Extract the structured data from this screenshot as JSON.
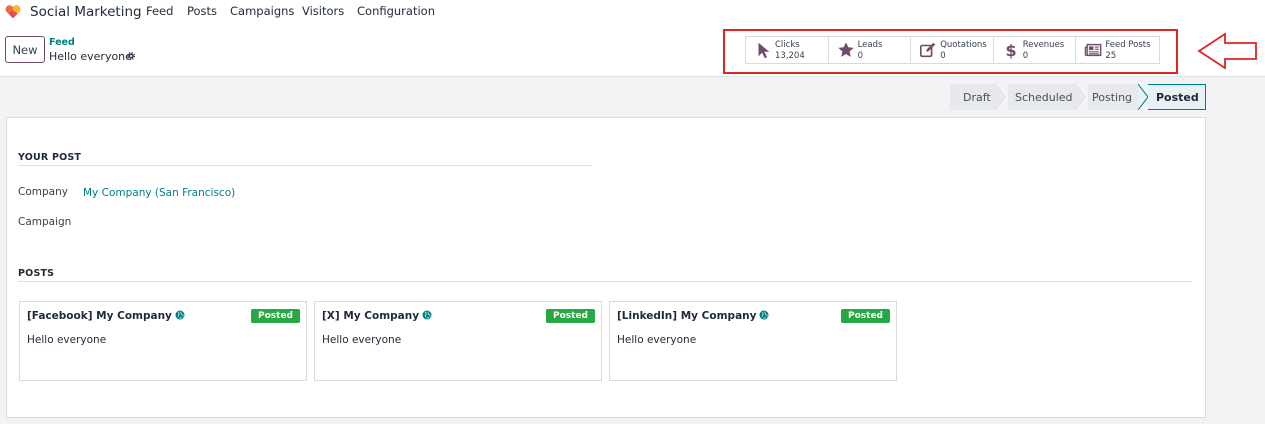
{
  "app": {
    "name": "Social Marketing",
    "logo_icon": "heart-icon",
    "nav": [
      "Feed",
      "Posts",
      "Campaigns",
      "Visitors",
      "Configuration"
    ]
  },
  "control": {
    "new_label": "New",
    "breadcrumb_parent": "Feed",
    "record_title": "Hello everyone",
    "settings_icon": "gear-icon"
  },
  "smart_buttons": [
    {
      "label": "Clicks",
      "value": "13,204",
      "icon": "cursor-icon"
    },
    {
      "label": "Leads",
      "value": "0",
      "icon": "star-icon"
    },
    {
      "label": "Quotations",
      "value": "0",
      "icon": "edit-icon"
    },
    {
      "label": "Revenues",
      "value": "0",
      "icon": "dollar-icon"
    },
    {
      "label": "Feed Posts",
      "value": "25",
      "icon": "newspaper-icon"
    }
  ],
  "status": {
    "stages": [
      "Draft",
      "Scheduled",
      "Posting",
      "Posted"
    ],
    "active": "Posted"
  },
  "form": {
    "your_post_title": "YOUR POST",
    "company_label": "Company",
    "company_value": "My Company (San Francisco)",
    "campaign_label": "Campaign",
    "campaign_value": "",
    "posts_title": "POSTS"
  },
  "posts": [
    {
      "title": "[Facebook] My Company",
      "status": "Posted",
      "message": "Hello everyone"
    },
    {
      "title": "[X] My Company",
      "status": "Posted",
      "message": "Hello everyone"
    },
    {
      "title": "[LinkedIn] My Company",
      "status": "Posted",
      "message": "Hello everyone"
    }
  ],
  "colors": {
    "brand": "#714b67",
    "link": "#017e84",
    "posted_badge": "#28a745",
    "annotation": "#e02424"
  }
}
